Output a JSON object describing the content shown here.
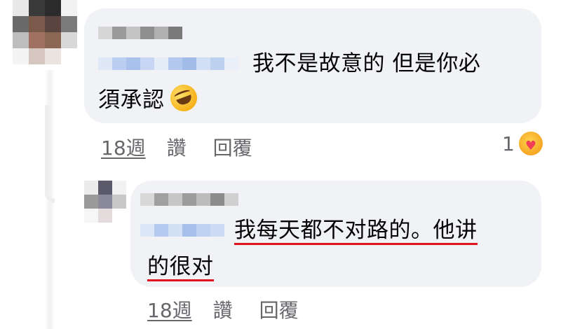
{
  "comments": [
    {
      "text_line1": "我不是故意的 但是你必",
      "text_line2": "須承認",
      "time": "18週",
      "like_label": "讚",
      "reply_label": "回覆",
      "reaction_count": "1",
      "emoji_icon": "rolling-on-floor-laughing-emoji",
      "reaction_icon": "care-reaction-icon"
    },
    {
      "text_line1": "我每天都不对路的。他讲",
      "text_line2": "的很对",
      "time": "18週",
      "like_label": "讚",
      "reply_label": "回覆"
    }
  ],
  "colors": {
    "bubble": "#f0f2f5",
    "meta_text": "#65676b",
    "highlight_underline": "#e0141e"
  }
}
